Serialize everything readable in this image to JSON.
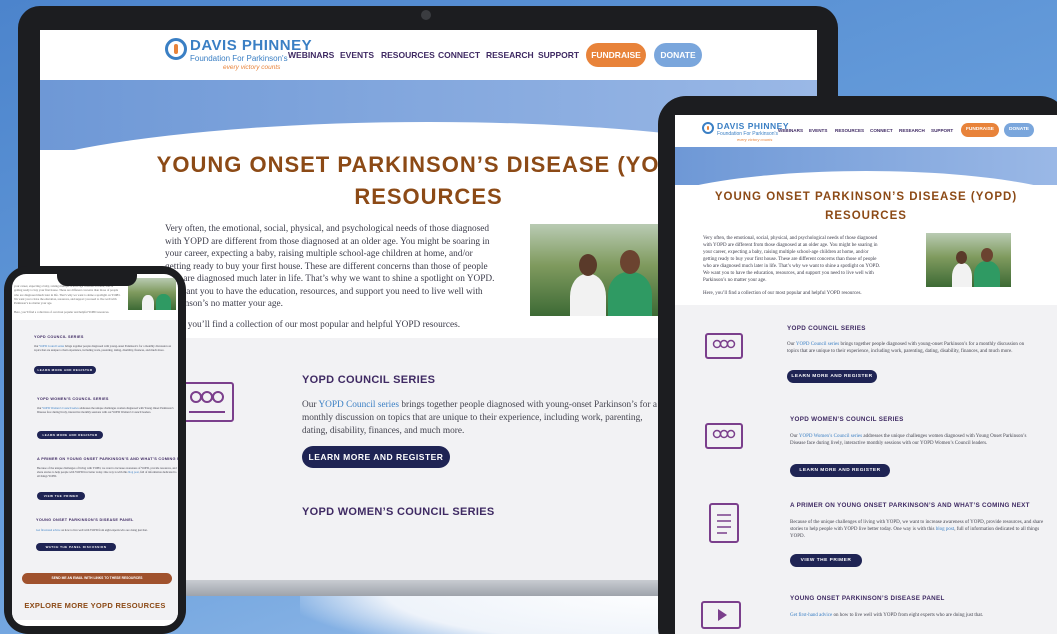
{
  "site": {
    "logo_title": "DAVIS PHINNEY",
    "logo_subtitle": "Foundation For Parkinson's",
    "logo_tagline": "every victory counts",
    "nav": [
      "WEBINARS",
      "EVENTS",
      "RESOURCES",
      "CONNECT",
      "RESEARCH",
      "SUPPORT"
    ],
    "fundraise_label": "FUNDRAISE",
    "donate_label": "DONATE"
  },
  "page": {
    "title_line1": "YOUNG ONSET PARKINSON’S DISEASE (YOPD)",
    "title_line2": "RESOURCES",
    "intro_lines": [
      "Very often, the emotional, social, physical, and psychological needs of those diagnosed",
      "with YOPD are different from those diagnosed at an older age. You might be soaring in",
      "your career, expecting a baby, raising multiple school-age children at home, and/or",
      "getting ready to buy your first house. These are different concerns than those of people",
      "who are diagnosed much later in life. That’s why we want to shine a spotlight on YOPD.",
      "We want you to have the education, resources, and support you need to live well with",
      "Parkinson’s no matter your age."
    ],
    "intro_followup": "Here, you’ll find a collection of our most popular and helpful YOPD resources."
  },
  "sections": [
    {
      "title": "YOPD COUNCIL SERIES",
      "text_pre": "Our ",
      "link": "YOPD Council series",
      "text_post": " brings together people diagnosed with young-onset Parkinson’s for a monthly discussion on topics that are unique to their experience, including work, parenting, dating, disability, finances, and much more.",
      "button": "LEARN MORE AND REGISTER",
      "icon": "group-video-icon"
    },
    {
      "title": "YOPD WOMEN’S COUNCIL SERIES",
      "text_pre": "Our ",
      "link": "YOPD Women’s Council series",
      "text_post": " addresses the unique challenges women diagnosed with Young Onset Parkinson’s Disease face during lively, interactive monthly sessions with our YOPD Women’s Council leaders.",
      "button": "LEARN MORE AND REGISTER",
      "icon": "group-video-icon"
    },
    {
      "title": "A PRIMER ON YOUNG ONSET PARKINSON’S AND WHAT’S COMING NEXT",
      "text_pre": "Because of the unique challenges of living with YOPD, we want to increase awareness of YOPD, provide resources, and share stories to help people with YOPD live better today. One way is with this ",
      "link": "blog post",
      "text_post": ", full of information dedicated to all things YOPD.",
      "button": "VIEW THE PRIMER",
      "icon": "document-icon"
    },
    {
      "title": "YOUNG ONSET PARKINSON’S DISEASE PANEL",
      "text_pre": "",
      "link": "Get first-hand advice",
      "text_post": " on how to live well with YOPD from eight experts who are doing just that.",
      "button": "WATCH THE PANEL DISCUSSION",
      "icon": "play-icon"
    }
  ],
  "phone": {
    "email_button": "SEND ME AN EMAIL WITH LINKS TO THESE RESOURCES",
    "explore_heading": "EXPLORE MORE YOPD RESOURCES"
  }
}
